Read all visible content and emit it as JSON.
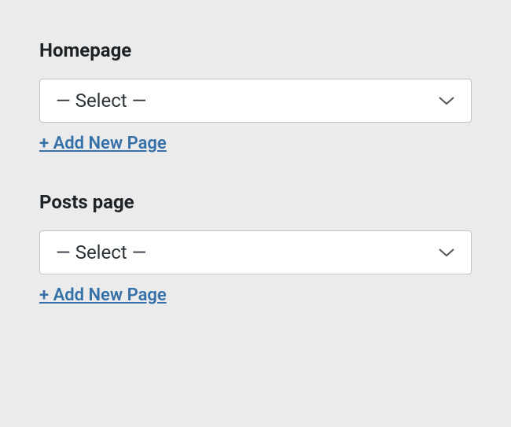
{
  "homepage": {
    "label": "Homepage",
    "select_value": "— Select —",
    "add_link": "+ Add New Page"
  },
  "posts_page": {
    "label": "Posts page",
    "select_value": "— Select —",
    "add_link": "+ Add New Page"
  }
}
